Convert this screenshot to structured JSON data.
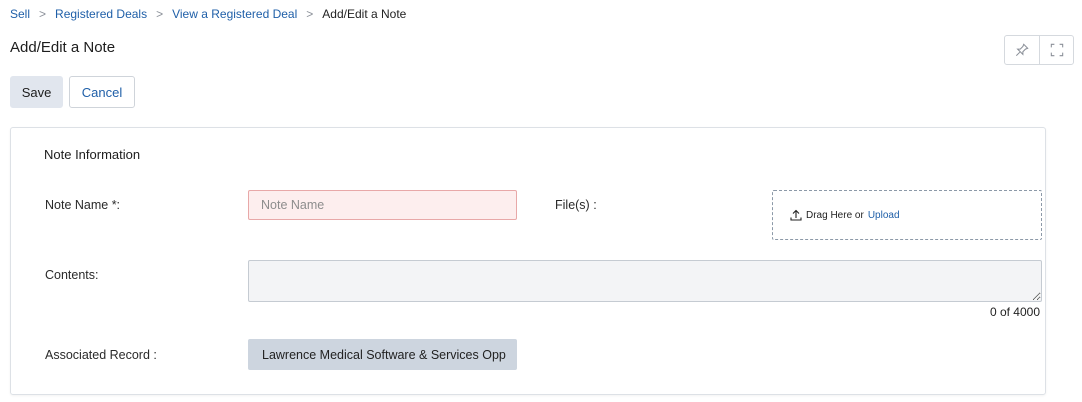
{
  "breadcrumb": {
    "items": [
      "Sell",
      "Registered Deals",
      "View a Registered Deal"
    ],
    "current": "Add/Edit a Note"
  },
  "page": {
    "title": "Add/Edit a Note"
  },
  "toolbar": {
    "save_label": "Save",
    "cancel_label": "Cancel"
  },
  "top_actions": {
    "icons": [
      "pin-icon",
      "fullscreen-icon"
    ]
  },
  "form": {
    "section_title": "Note Information",
    "note_name": {
      "label": "Note Name *:",
      "placeholder": "Note Name",
      "value": ""
    },
    "files": {
      "label": "File(s) :",
      "drag_text": "Drag Here or",
      "upload_label": "Upload"
    },
    "contents": {
      "label": "Contents:",
      "value": "",
      "counter": "0 of 4000"
    },
    "associated_record": {
      "label": "Associated Record :",
      "value": "Lawrence Medical Software & Services Opp"
    }
  },
  "colors": {
    "link": "#1f5fa8",
    "required_bg": "#fdeeee",
    "required_border": "#e8a8a8"
  }
}
